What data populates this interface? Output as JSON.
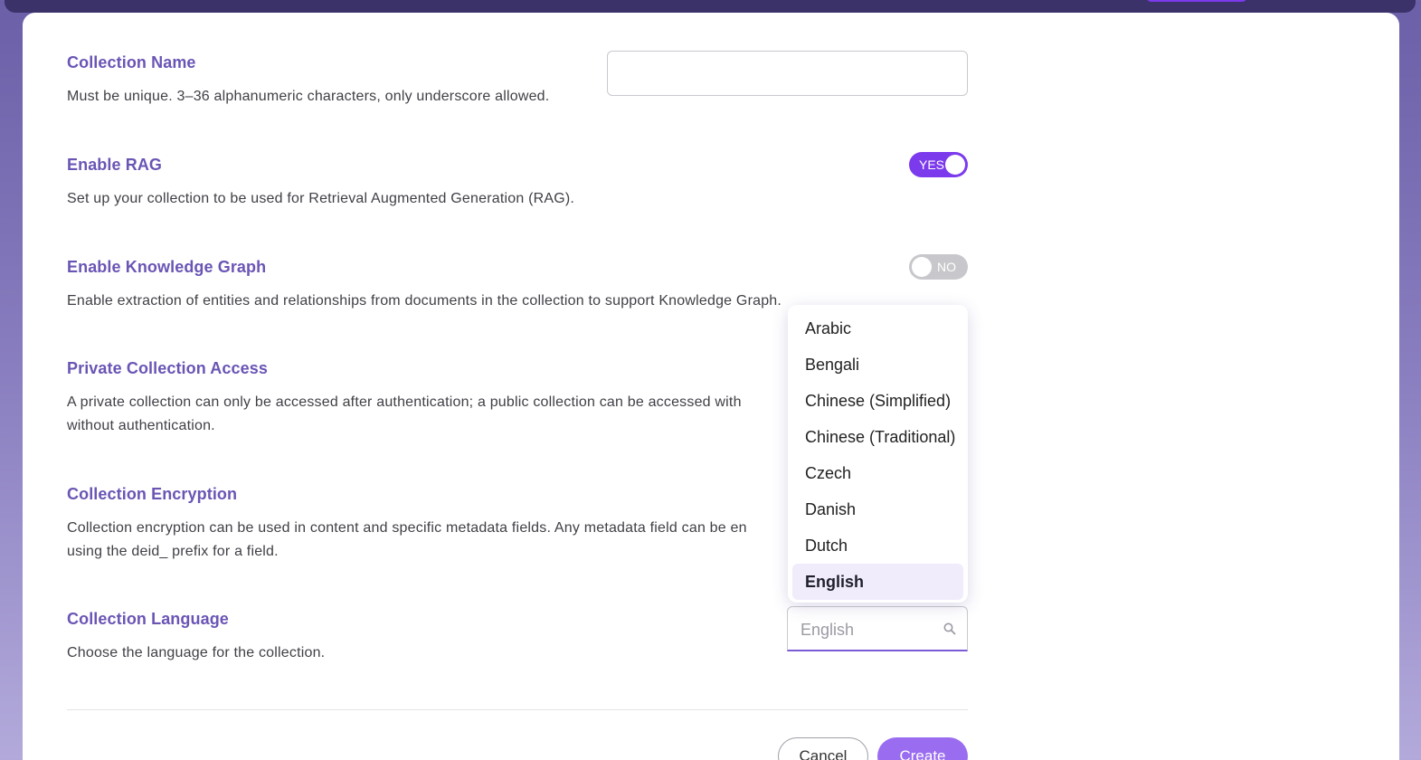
{
  "sections": {
    "name": {
      "title": "Collection Name",
      "desc": "Must be unique. 3–36 alphanumeric characters, only underscore allowed.",
      "input_value": ""
    },
    "rag": {
      "title": "Enable RAG",
      "desc": "Set up your collection to be used for Retrieval Augmented Generation (RAG).",
      "toggle_label": "YES",
      "enabled": true
    },
    "kg": {
      "title": "Enable Knowledge Graph",
      "desc": "Enable extraction of entities and relationships from documents in the collection to support Knowledge Graph.",
      "toggle_label": "NO",
      "enabled": false
    },
    "access": {
      "title": "Private Collection Access",
      "desc_line1": "A private collection can only be accessed after authentication; a public collection can be accessed with",
      "desc_line2": "without authentication."
    },
    "encryption": {
      "title": "Collection Encryption",
      "desc_line1": "Collection encryption can be used in content and specific metadata fields. Any metadata field can be en",
      "desc_line2": "using the deid_ prefix for a field."
    },
    "language": {
      "title": "Collection Language",
      "desc": "Choose the language for the collection.",
      "value": "English",
      "icon": "search-icon"
    }
  },
  "language_dropdown": {
    "options": [
      "Arabic",
      "Bengali",
      "Chinese (Simplified)",
      "Chinese (Traditional)",
      "Czech",
      "Danish",
      "Dutch",
      "English"
    ],
    "selected": "English"
  },
  "footer": {
    "cancel_label": "Cancel",
    "create_label": "Create"
  },
  "colors": {
    "accent": "#7c3aed",
    "title": "#6a55b5",
    "create_button": "#9a6cf0"
  }
}
